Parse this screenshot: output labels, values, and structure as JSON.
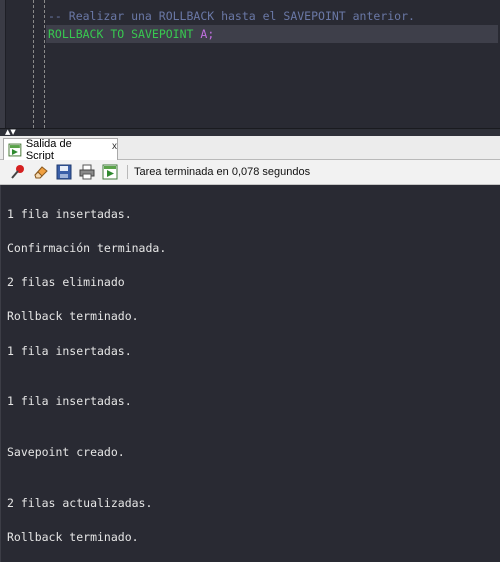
{
  "editor": {
    "comment_line": "-- Realizar una ROLLBACK hasta el SAVEPOINT anterior.",
    "code_line": {
      "keyword_rollback": "ROLLBACK",
      "keyword_to": "TO",
      "keyword_savepoint": "SAVEPOINT",
      "identifier": "A",
      "terminator": ";"
    }
  },
  "output_panel": {
    "tab_label": "Salida de Script",
    "tab_close": "x",
    "status": "Tarea terminada en 0,078 segundos",
    "toolbar_icons": [
      "pin-icon",
      "eraser-icon",
      "save-icon",
      "print-icon",
      "run-script-icon"
    ]
  },
  "output_lines": [
    "1 fila insertadas.",
    "Confirmación terminada.",
    "2 filas eliminado",
    "Rollback terminado.",
    "1 fila insertadas.",
    "1 fila insertadas.",
    "Savepoint creado.",
    "2 filas actualizadas.",
    "Rollback terminado."
  ],
  "colors": {
    "editor_bg": "#292a33",
    "comment": "#6a78a6",
    "keyword": "#38c950",
    "identifier": "#c070e0"
  }
}
